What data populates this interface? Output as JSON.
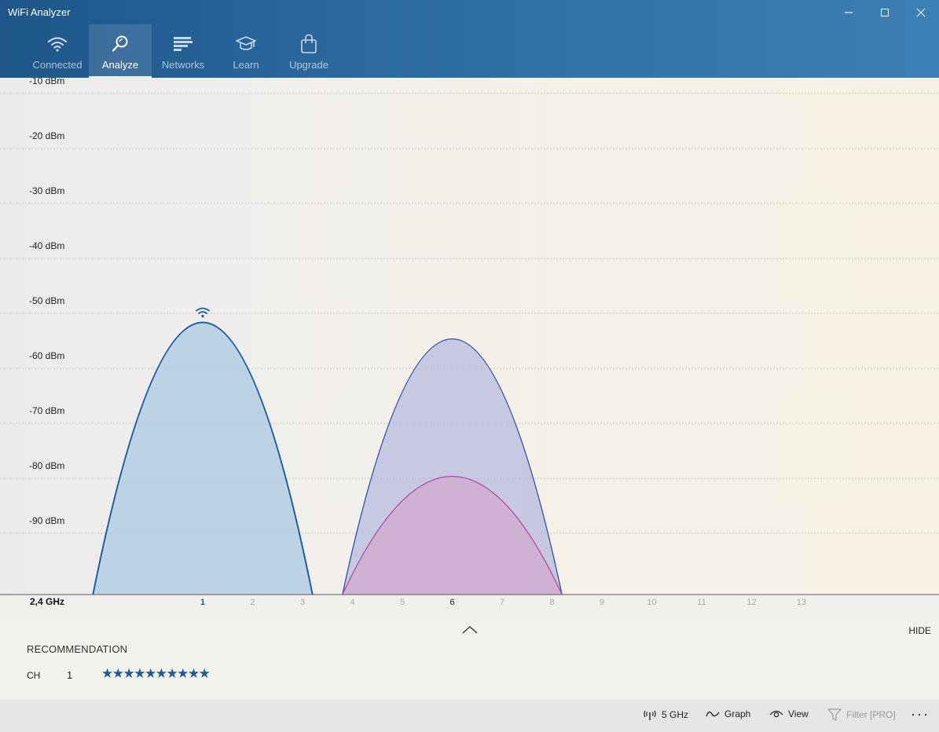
{
  "app": {
    "title": "WiFi Analyzer"
  },
  "nav": {
    "items": [
      {
        "label": "Connected",
        "icon": "wifi-icon",
        "active": false
      },
      {
        "label": "Analyze",
        "icon": "magnifier-icon",
        "active": true
      },
      {
        "label": "Networks",
        "icon": "list-icon",
        "active": false
      },
      {
        "label": "Learn",
        "icon": "graduation-cap-icon",
        "active": false
      },
      {
        "label": "Upgrade",
        "icon": "shopping-bag-icon",
        "active": false
      }
    ]
  },
  "window_controls": [
    "minimize-icon",
    "maximize-icon",
    "close-icon"
  ],
  "chart_data": {
    "type": "area",
    "band_label": "2,4 GHz",
    "x_ticks": [
      "1",
      "2",
      "3",
      "4",
      "5",
      "6",
      "7",
      "8",
      "9",
      "10",
      "11",
      "12",
      "13"
    ],
    "highlighted_channels": [
      "1",
      "6"
    ],
    "y_ticks": [
      "-10 dBm",
      "-20 dBm",
      "-30 dBm",
      "-40 dBm",
      "-50 dBm",
      "-60 dBm",
      "-70 dBm",
      "-80 dBm",
      "-90 dBm"
    ],
    "ylim": [
      -100,
      0
    ],
    "grid": true,
    "series": [
      {
        "channel": 1,
        "peak_dbm": -50.5,
        "connected": true,
        "stroke": "#1f5fa0",
        "fill": "#a9c8e2"
      },
      {
        "channel": 6,
        "peak_dbm": -53.5,
        "connected": false,
        "stroke": "#2f50a8",
        "fill": "#b5b9de"
      },
      {
        "channel": 6,
        "peak_dbm": -78.5,
        "connected": false,
        "stroke": "#b04aa8",
        "fill": "#d3a7cf"
      }
    ]
  },
  "recommendation": {
    "collapse_icon": "chevron-up-icon",
    "hide_label": "HIDE",
    "title": "RECOMMENDATION",
    "ch_label": "CH",
    "ch_value": "1",
    "stars": "★★★★★★★★★★",
    "rating": 10
  },
  "commands": {
    "band": {
      "label": "5 GHz",
      "icon": "antenna-icon"
    },
    "graph": {
      "label": "Graph",
      "icon": "wave-icon"
    },
    "view": {
      "label": "View",
      "icon": "eye-icon"
    },
    "filter": {
      "label": "Filter [PRO]",
      "icon": "funnel-icon",
      "enabled": false
    },
    "more": {
      "label": "···",
      "icon": "more-icon"
    }
  }
}
